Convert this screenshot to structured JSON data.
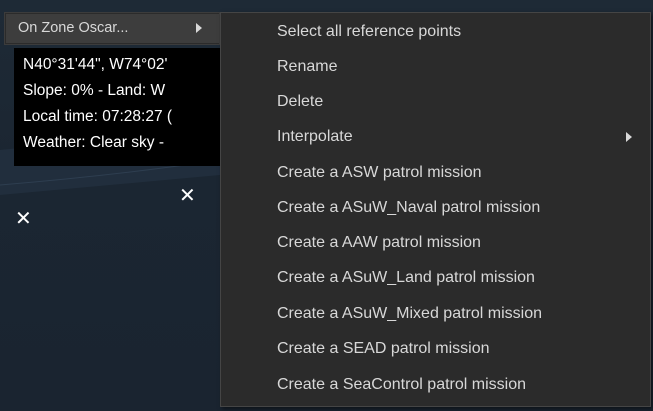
{
  "parent_menu": {
    "item_label": "On Zone Oscar...",
    "arrow_icon": "chevron-right-icon"
  },
  "info": {
    "lines": [
      "N40°31'44\", W74°02'",
      "Slope: 0%  - Land: W",
      "Local time: 07:28:27 (",
      "Weather: Clear sky -"
    ]
  },
  "map": {
    "markers": [
      "reference-point-marker",
      "reference-point-marker"
    ],
    "marker_glyph": "✕"
  },
  "submenu": {
    "items": [
      {
        "label": "Select all reference points"
      },
      {
        "label": "Rename"
      },
      {
        "label": "Delete"
      },
      {
        "label": "Interpolate",
        "has_submenu": true
      },
      {
        "label": "Create a ASW patrol mission"
      },
      {
        "label": "Create a ASuW_Naval patrol mission"
      },
      {
        "label": "Create a AAW patrol mission"
      },
      {
        "label": "Create a ASuW_Land patrol mission"
      },
      {
        "label": "Create a ASuW_Mixed patrol mission"
      },
      {
        "label": "Create a SEAD patrol mission"
      },
      {
        "label": "Create a SeaControl patrol mission"
      }
    ]
  },
  "colors": {
    "menu_bg": "#2b2b2b",
    "menu_text": "#d8d8d8",
    "highlight_bg": "#3d3d3d",
    "map_bg": "#1a2430"
  }
}
